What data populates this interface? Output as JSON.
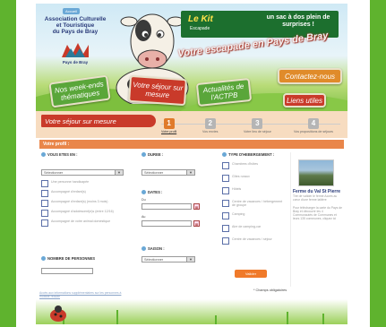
{
  "header": {
    "accueil": "Accueil",
    "association": [
      "Association Culturelle",
      "et Touristique",
      "du Pays de Bray"
    ],
    "logo_text": "Pays de Bray",
    "banner_kit": "Le Kit",
    "banner_kit_sub": "Escapade",
    "banner_tagline": "un sac à dos plein de surprises !",
    "slogan": "Votre escapade en Pays de Bray"
  },
  "nav": {
    "weekends": "Nos week-ends thématiques",
    "sejour": "Votre séjour sur mesure",
    "actualites": "Actualités de l'ACTPB",
    "contact": "Contactez-nous",
    "liens": "Liens utiles"
  },
  "steps": {
    "title": "Votre séjour sur mesure",
    "items": [
      {
        "num": "1",
        "label": "Votre profil"
      },
      {
        "num": "2",
        "label": "Vos envies"
      },
      {
        "num": "3",
        "label": "Votre lieu de séjour"
      },
      {
        "num": "4",
        "label": "Vos propositions de séjours"
      }
    ]
  },
  "profil_title": "Votre profil :",
  "vous_etes": {
    "label": "VOUS ETES EN :",
    "select_value": "Sélectionner",
    "options": [
      "Une personne handicapée",
      "Accompagné d'enfant(s)",
      "Accompagné d'enfant(s) (moins 3 mois)",
      "Accompagné d'adolescent(e)s (entre 12/16)",
      "Accompagné de votre animal domestique"
    ]
  },
  "nb_personnes": {
    "label": "NOMBRE DE PERSONNES"
  },
  "footer_link": "Accès aux informations supplémentaires sur les personnes à mobilité réduite",
  "duree": {
    "label": "DUREE :",
    "select_value": "Sélectionner"
  },
  "dates": {
    "label": "DATES :",
    "du": "Du",
    "au": "Au"
  },
  "saison": {
    "label": "SAISON :",
    "select_value": "Sélectionner"
  },
  "hebergement": {
    "label": "TYPE D'HEBERGEMENT :",
    "options": [
      "Chambres d'hôtes",
      "Gîtes ruraux",
      "Hôtels",
      "Centre de vacances / hébergement de groupe",
      "Camping",
      "Aire de camping-car",
      "Centre de vacances / séjour"
    ]
  },
  "ok_button": "Valider",
  "note": "* Champs obligatoires",
  "sidebar": {
    "ferme_name": "Ferme du Val St Pierre",
    "ferme_desc": "Tiré de valider le fermé Accès au cœur d'une ferme laitière",
    "more_text": "Pour télécharger la carte du Pays de Bray et découvrir les 4 Communautés de Communes et leurs 135 communes, cliquez ici"
  },
  "colors": {
    "green": "#5fb32e",
    "red": "#c93a2a",
    "orange": "#e9864a",
    "blue": "#2a3b7a"
  }
}
